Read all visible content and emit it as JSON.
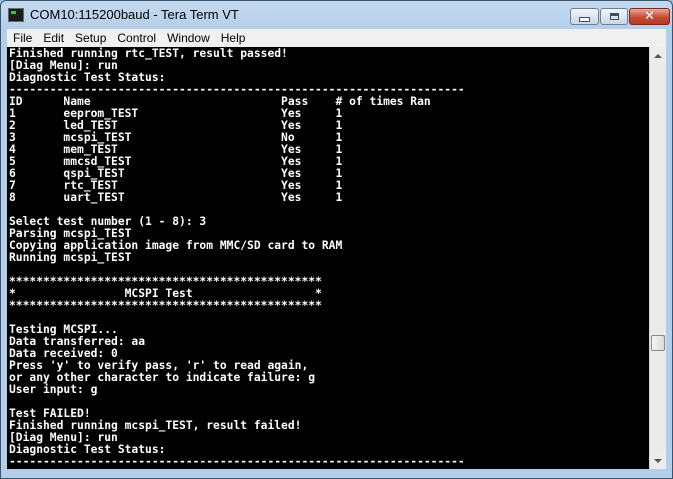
{
  "window": {
    "title": "COM10:115200baud - Tera Term VT"
  },
  "menu": {
    "items": [
      "File",
      "Edit",
      "Setup",
      "Control",
      "Window",
      "Help"
    ]
  },
  "terminal": {
    "lines": [
      "Finished running rtc_TEST, result passed!",
      "[Diag Menu]: run",
      "Diagnostic Test Status:",
      "-------------------------------------------------------------------",
      "ID      Name                            Pass    # of times Ran",
      "1       eeprom_TEST                     Yes     1",
      "2       led_TEST                        Yes     1",
      "3       mcspi_TEST                      No      1",
      "4       mem_TEST                        Yes     1",
      "5       mmcsd_TEST                      Yes     1",
      "6       qspi_TEST                       Yes     1",
      "7       rtc_TEST                        Yes     1",
      "8       uart_TEST                       Yes     1",
      "",
      "Select test number (1 - 8): 3",
      "Parsing mcspi_TEST",
      "Copying application image from MMC/SD card to RAM",
      "Running mcspi_TEST",
      "",
      "**********************************************",
      "*                MCSPI Test                  *",
      "**********************************************",
      "",
      "Testing MCSPI...",
      "Data transferred: aa",
      "Data received: 0",
      "Press 'y' to verify pass, 'r' to read again,",
      "or any other character to indicate failure: g",
      "User input: g",
      "",
      "Test FAILED!",
      "Finished running mcspi_TEST, result failed!",
      "[Diag Menu]: run",
      "Diagnostic Test Status:",
      "-------------------------------------------------------------------"
    ]
  },
  "icons": {
    "minimize": "minimize-icon",
    "maximize": "maximize-icon",
    "close": "close-icon",
    "scroll_up": "arrow-up-icon",
    "scroll_down": "arrow-down-icon"
  },
  "colors": {
    "terminal_bg": "#000000",
    "terminal_fg": "#ffffff",
    "close_button": "#c74a33"
  }
}
